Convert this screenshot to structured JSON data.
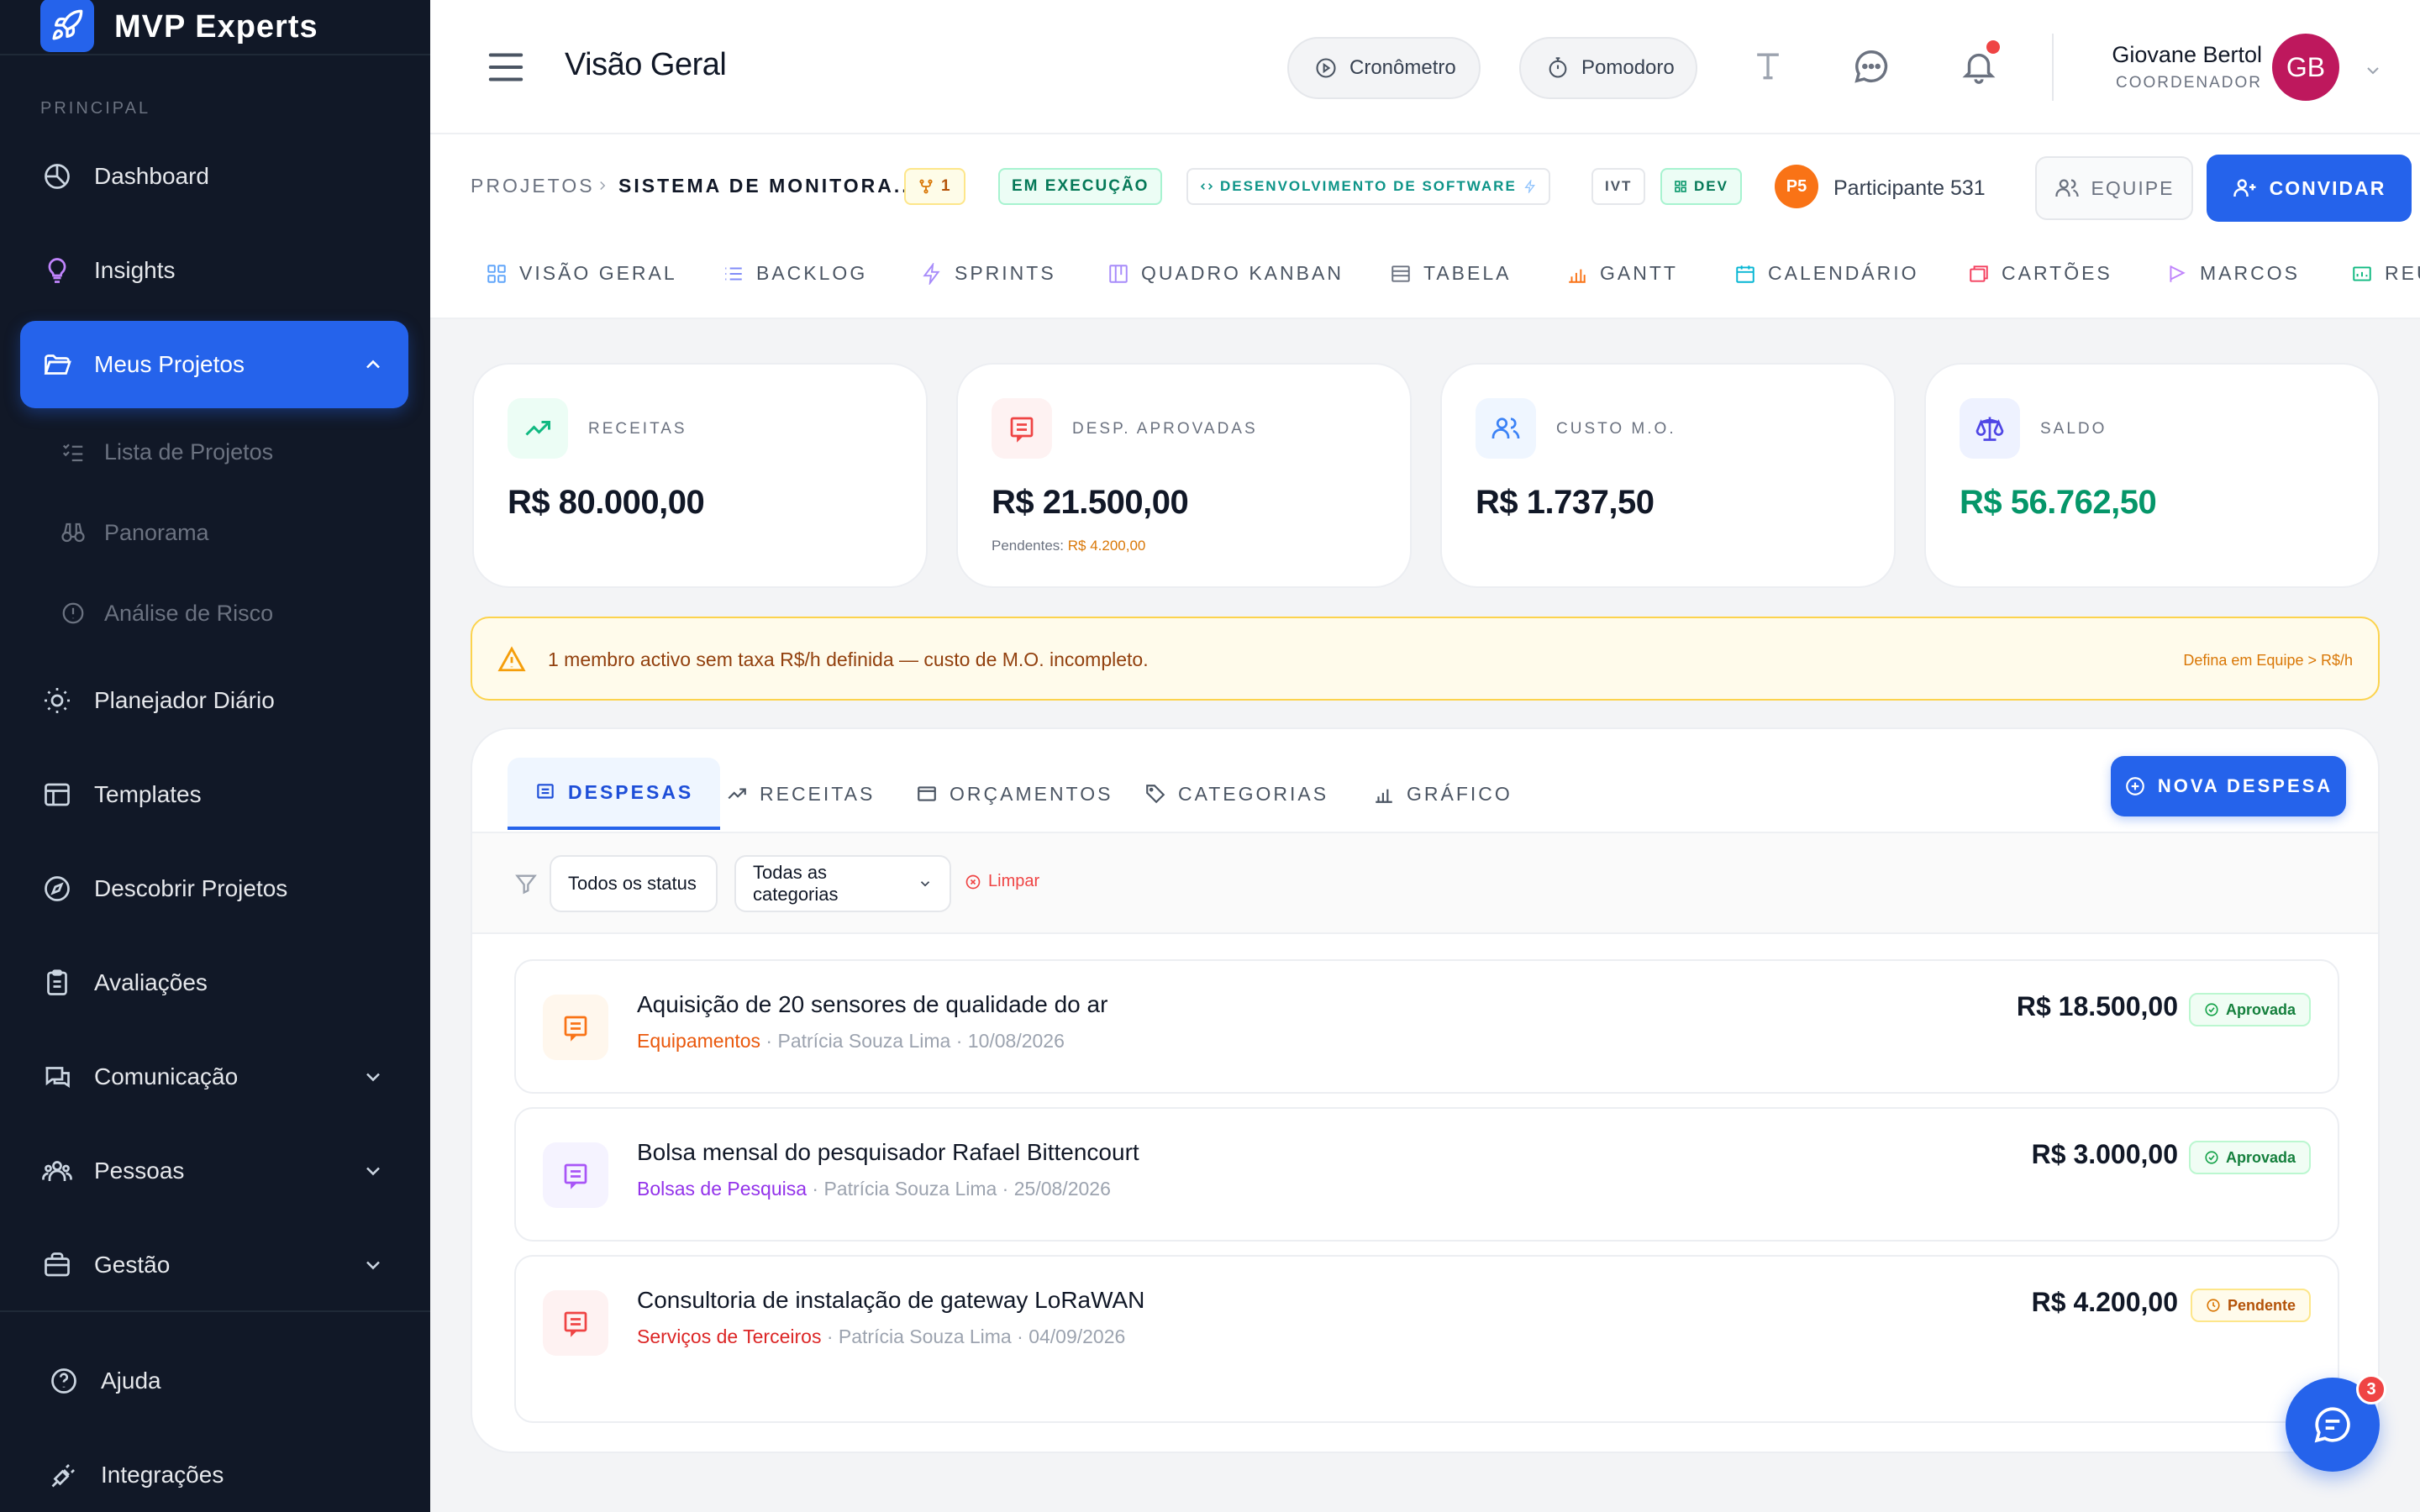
{
  "app": {
    "name": "MVP Experts"
  },
  "sidebar": {
    "section_label": "PRINCIPAL",
    "items": [
      {
        "label": "Dashboard",
        "icon": "dashboard-icon"
      },
      {
        "label": "Insights",
        "icon": "lightbulb-icon"
      },
      {
        "label": "Meus Projetos",
        "icon": "folder-icon",
        "active": true
      },
      {
        "label": "Planejador Diário",
        "icon": "sun-icon"
      },
      {
        "label": "Templates",
        "icon": "layout-icon"
      },
      {
        "label": "Descobrir Projetos",
        "icon": "compass-icon"
      },
      {
        "label": "Avaliações",
        "icon": "clipboard-icon"
      },
      {
        "label": "Comunicação",
        "icon": "chat-icon"
      },
      {
        "label": "Pessoas",
        "icon": "users-icon"
      },
      {
        "label": "Gestão",
        "icon": "briefcase-icon"
      }
    ],
    "sub_items": [
      {
        "label": "Lista de Projetos",
        "icon": "list-check-icon"
      },
      {
        "label": "Panorama",
        "icon": "binoculars-icon"
      },
      {
        "label": "Análise de Risco",
        "icon": "alert-circle-icon"
      }
    ],
    "bottom": [
      {
        "label": "Ajuda",
        "icon": "help-icon"
      },
      {
        "label": "Integrações",
        "icon": "plug-icon"
      }
    ]
  },
  "header": {
    "title": "Visão Geral",
    "cronometro": "Cronômetro",
    "pomodoro": "Pomodoro",
    "user_name": "Giovane Bertol",
    "user_role": "COORDENADOR",
    "user_initials": "GB"
  },
  "project": {
    "crumb_root": "PROJETOS",
    "crumb_current": "SISTEMA DE MONITORA...",
    "fork_count": "1",
    "status": "EM EXECUÇÃO",
    "category": "DESENVOLVIMENTO DE SOFTWARE",
    "tag_ivt": "IVT",
    "tag_dev": "DEV",
    "participant_initials": "P5",
    "participant_name": "Participante 531",
    "team_button": "EQUIPE",
    "invite_button": "CONVIDAR",
    "tabs": [
      "VISÃO GERAL",
      "BACKLOG",
      "SPRINTS",
      "QUADRO KANBAN",
      "TABELA",
      "GANTT",
      "CALENDÁRIO",
      "CARTÕES",
      "MARCOS",
      "REU"
    ]
  },
  "stats": [
    {
      "label": "RECEITAS",
      "value": "R$ 80.000,00",
      "color": "#111827"
    },
    {
      "label": "DESP. APROVADAS",
      "value": "R$ 21.500,00",
      "sub_label": "Pendentes:",
      "sub_value": "R$ 4.200,00",
      "color": "#111827"
    },
    {
      "label": "CUSTO M.O.",
      "value": "R$ 1.737,50",
      "color": "#111827"
    },
    {
      "label": "SALDO",
      "value": "R$ 56.762,50",
      "color": "#059669"
    }
  ],
  "alert": {
    "text": "1 membro activo sem taxa R$/h definida — custo de M.O. incompleto.",
    "link": "Defina em Equipe > R$/h"
  },
  "finance": {
    "tabs": [
      "DESPESAS",
      "RECEITAS",
      "ORÇAMENTOS",
      "CATEGORIAS",
      "GRÁFICO"
    ],
    "new_button": "NOVA DESPESA",
    "filter_status": "Todos os status",
    "filter_category": "Todas as categorias",
    "clear": "Limpar",
    "expenses": [
      {
        "title": "Aquisição de 20 sensores de qualidade do ar",
        "category": "Equipamentos",
        "category_color": "#ea580c",
        "person": "Patrícia Souza Lima",
        "date": "10/08/2026",
        "amount": "R$ 18.500,00",
        "status": "Aprovada"
      },
      {
        "title": "Bolsa mensal do pesquisador Rafael Bittencourt",
        "category": "Bolsas de Pesquisa",
        "category_color": "#9333ea",
        "person": "Patrícia Souza Lima",
        "date": "25/08/2026",
        "amount": "R$ 3.000,00",
        "status": "Aprovada"
      },
      {
        "title": "Consultoria de instalação de gateway LoRaWAN",
        "category": "Serviços de Terceiros",
        "category_color": "#dc2626",
        "person": "Patrícia Souza Lima",
        "date": "04/09/2026",
        "amount": "R$ 4.200,00",
        "status": "Pendente"
      }
    ]
  },
  "chat_badge": "3"
}
